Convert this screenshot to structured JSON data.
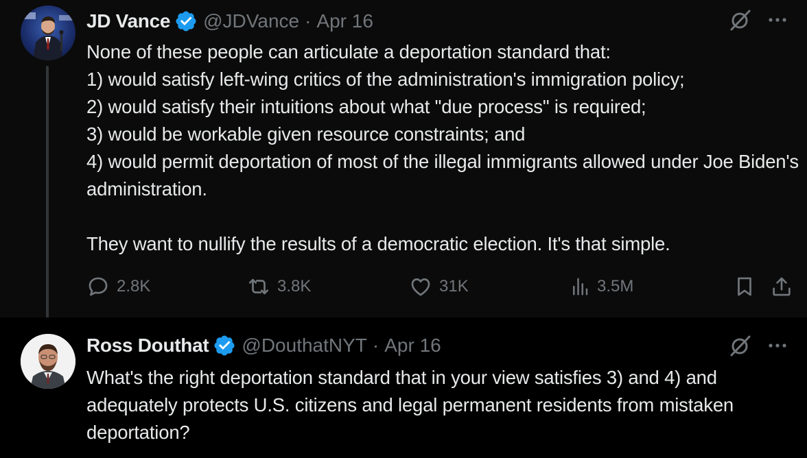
{
  "tweets": [
    {
      "name": "JD Vance",
      "handle": "@JDVance",
      "separator": "·",
      "date": "Apr 16",
      "text": "None of these people can articulate a deportation standard that:\n1) would satisfy left-wing critics of the administration's immigration policy;\n2) would satisfy their intuitions about what \"due process\" is required;\n3) would be workable given resource constraints; and\n4) would permit deportation of most of the illegal immigrants allowed under Joe Biden's administration.\n\nThey want to nullify the results of a democratic election. It's that simple.",
      "stats": {
        "replies": "2.8K",
        "reposts": "3.8K",
        "likes": "31K",
        "views": "3.5M"
      }
    },
    {
      "name": "Ross Douthat",
      "handle": "@DouthatNYT",
      "separator": "·",
      "date": "Apr 16",
      "text": "What's the right deportation standard that in your view satisfies 3) and 4) and adequately protects U.S. citizens and legal permanent residents from mistaken deportation?"
    }
  ],
  "colors": {
    "background": "#000000",
    "focused_background": "#0b0b0b",
    "text": "#e7e9ea",
    "secondary": "#71767b",
    "verified": "#1d9bf0"
  }
}
